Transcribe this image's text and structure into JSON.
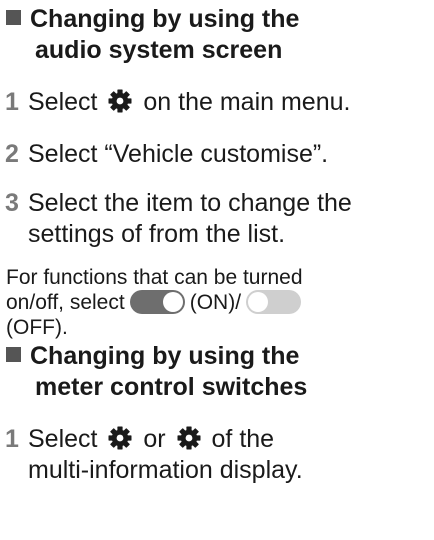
{
  "section1": {
    "heading_line1": "Changing by using the",
    "heading_line2": "audio system screen"
  },
  "steps1": [
    {
      "num": "1",
      "before_icon": "Select",
      "after_icon": "on the main menu.",
      "icon": "gear-icon"
    },
    {
      "num": "2",
      "text": "Select “Vehicle customise”."
    },
    {
      "num": "3",
      "line1": "Select the item to change the",
      "line2": "settings of from the list."
    }
  ],
  "note": {
    "line1": "For functions that can be turned",
    "line2_prefix": "on/off, select",
    "on_label": "(ON)/",
    "off_label": "(OFF)."
  },
  "section2": {
    "heading_line1": "Changing by using the",
    "heading_line2": "meter control switches"
  },
  "steps2": [
    {
      "num": "1",
      "before_icon": "Select",
      "middle": "or",
      "after_icon": "of the",
      "line2": "multi-information display.",
      "icons": [
        "gear-icon",
        "gear-icon"
      ]
    }
  ],
  "colors": {
    "text": "#1a1a1a",
    "step_number": "#7a7a7a",
    "heading_square": "#555555",
    "toggle_on": "#6e6e6e",
    "toggle_off": "#cfcfcf"
  }
}
